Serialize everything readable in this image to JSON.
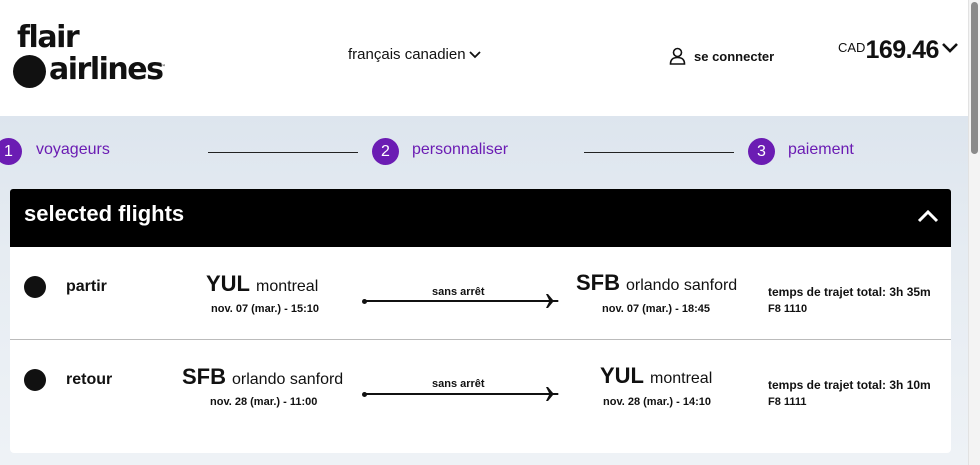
{
  "header": {
    "logo_line1": "flair",
    "logo_line2": "airlines",
    "logo_tm": "™",
    "language": "français canadien",
    "signin": "se connecter",
    "currency": "CAD",
    "total": "169.46"
  },
  "steps": [
    {
      "num": "1",
      "label": "voyageurs"
    },
    {
      "num": "2",
      "label": "personnaliser"
    },
    {
      "num": "3",
      "label": "paiement"
    }
  ],
  "selected": {
    "title": "selected flights"
  },
  "flights": [
    {
      "direction": "partir",
      "from_code": "YUL",
      "from_city": "montreal",
      "from_datetime": "nov. 07 (mar.) - 15:10",
      "stops": "sans arrêt",
      "to_code": "SFB",
      "to_city": "orlando sanford",
      "to_datetime": "nov. 07 (mar.) - 18:45",
      "duration": "temps de trajet total: 3h 35m",
      "flight_number": "F8 1110"
    },
    {
      "direction": "retour",
      "from_code": "SFB",
      "from_city": "orlando sanford",
      "from_datetime": "nov. 28 (mar.) - 11:00",
      "stops": "sans arrêt",
      "to_code": "YUL",
      "to_city": "montreal",
      "to_datetime": "nov. 28 (mar.) - 14:10",
      "duration": "temps de trajet total: 3h 10m",
      "flight_number": "F8 1111"
    }
  ],
  "colors": {
    "accent": "#6b1cb3",
    "bar": "#000000"
  }
}
